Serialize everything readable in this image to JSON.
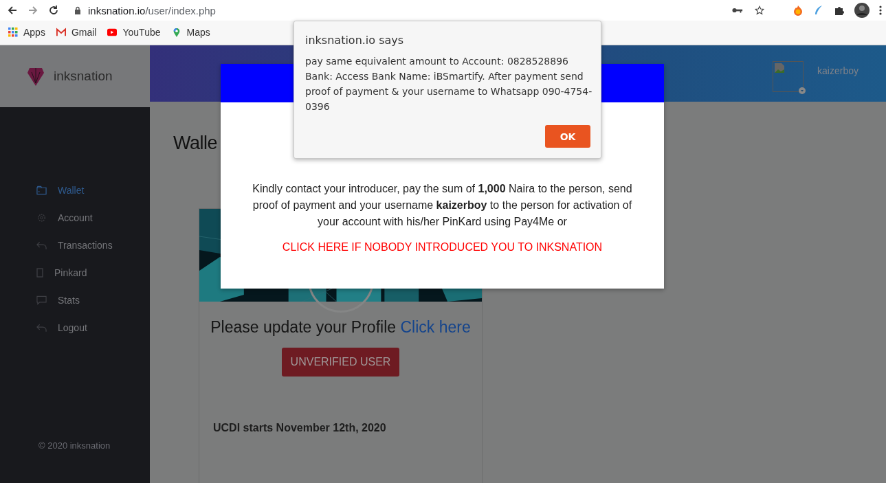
{
  "browser": {
    "url_host": "inksnation.io",
    "url_path": "/user/index.php",
    "bookmarks": [
      {
        "label": "Apps",
        "kind": "apps"
      },
      {
        "label": "Gmail",
        "kind": "mail"
      },
      {
        "label": "YouTube",
        "kind": "video"
      },
      {
        "label": "Maps",
        "kind": "pin"
      }
    ]
  },
  "header": {
    "brand": "inksnation",
    "username": "kaizerboy"
  },
  "sidebar": {
    "items": [
      {
        "label": "Wallet",
        "kind": "wallet",
        "selected": true
      },
      {
        "label": "Account",
        "kind": "gear",
        "selected": false
      },
      {
        "label": "Transactions",
        "kind": "return",
        "selected": false
      },
      {
        "label": "Pinkard",
        "kind": "card",
        "selected": false
      },
      {
        "label": "Stats",
        "kind": "chat",
        "selected": false
      },
      {
        "label": "Logout",
        "kind": "return",
        "selected": false
      }
    ],
    "footer": "© 2020 inksnation"
  },
  "page": {
    "heading": "Walle",
    "card": {
      "prompt": "Please update your Profile",
      "link": "Click here",
      "status_button": "UNVERIFIED USER",
      "announcement": "UCDI starts November 12th, 2020"
    }
  },
  "modal": {
    "message": "Kindly contact your introducer, pay the sum of **1,000** Naira to the person, send proof of payment and your username **kaizerboy** to the person for activation of your account with his/her PinKard using Pay4Me or",
    "link": "CLICK HERE IF NOBODY INTRODUCED YOU TO INKSNATION"
  },
  "alert": {
    "title": "inksnation.io says",
    "message": "pay same equivalent amount to Account: 0828528896 Bank: Access Bank Name: iBSmartify. After payment send proof of payment & your username to Whatsapp 090-4754-0396",
    "button": "OK"
  }
}
